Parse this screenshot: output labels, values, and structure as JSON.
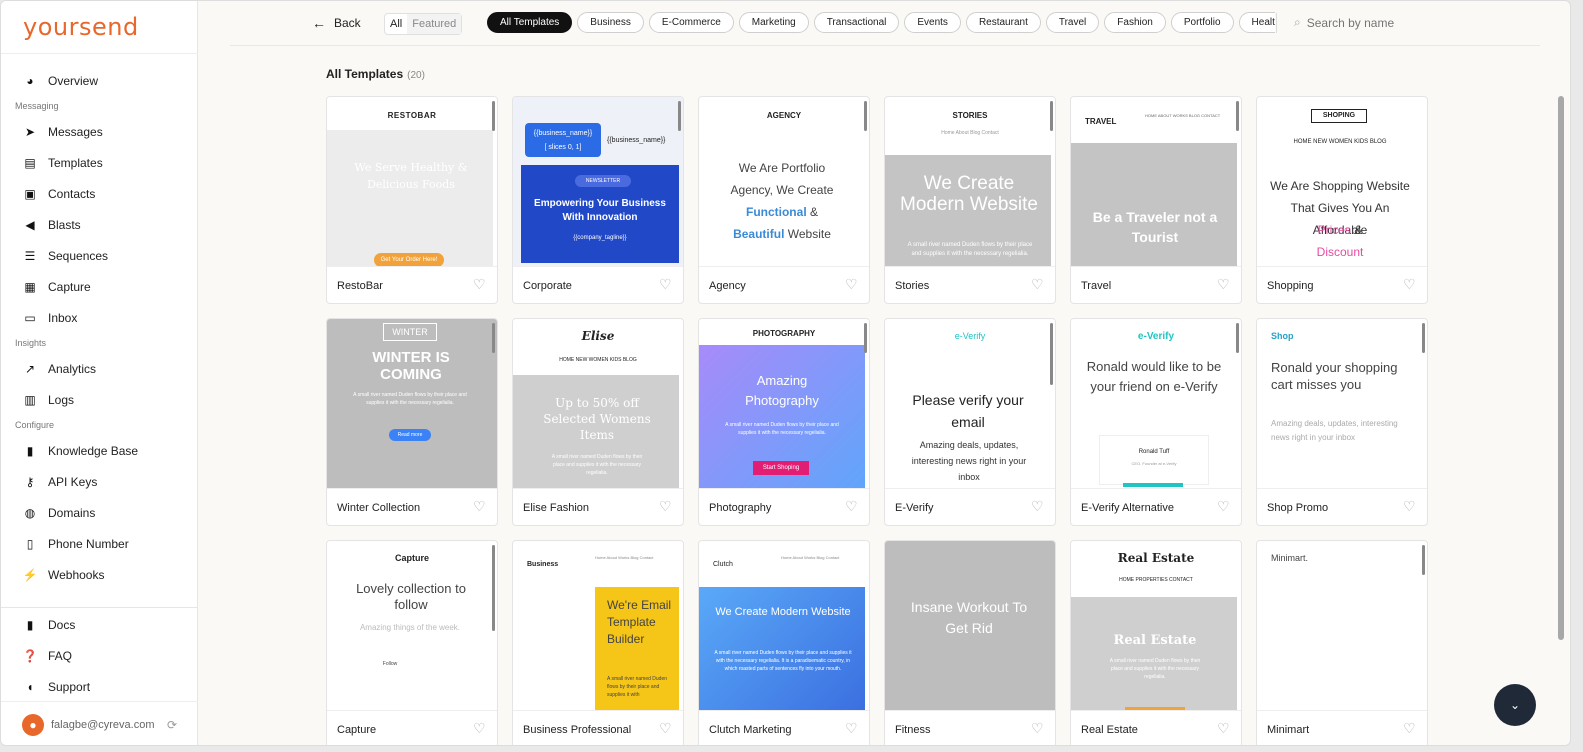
{
  "app": {
    "logo": "yoursend"
  },
  "sidebar": {
    "overview": "Overview",
    "sections": {
      "messaging": "Messaging",
      "insights": "Insights",
      "configure": "Configure"
    },
    "messaging": [
      "Messages",
      "Templates",
      "Contacts",
      "Blasts",
      "Sequences",
      "Capture",
      "Inbox"
    ],
    "insights": [
      "Analytics",
      "Logs"
    ],
    "configure": [
      "Knowledge Base",
      "API Keys",
      "Domains",
      "Phone Number",
      "Webhooks"
    ],
    "bottom": [
      "Docs",
      "FAQ",
      "Support"
    ],
    "user_email": "falagbe@cyreva.com"
  },
  "topbar": {
    "back_label": "Back",
    "toggle": [
      "All",
      "Featured"
    ],
    "chips": [
      "All Templates",
      "Business",
      "E-Commerce",
      "Marketing",
      "Transactional",
      "Events",
      "Restaurant",
      "Travel",
      "Fashion",
      "Portfolio",
      "Health &"
    ],
    "search_placeholder": "Search by name"
  },
  "main": {
    "title": "All Templates",
    "count": "(20)"
  },
  "cards": [
    {
      "name": "RestoBar",
      "t1": "RESTOBAR",
      "t2": "We Serve Healthy & Delicious Foods",
      "t3": "Get Your Order Here!"
    },
    {
      "name": "Corporate",
      "t1": "{{business_name}}",
      "t2": "[ slices 0, 1]",
      "t3": "{{business_name}}",
      "t4": "NEWSLETTER",
      "t5": "Empowering Your Business With Innovation",
      "t6": "{{company_tagline}}"
    },
    {
      "name": "Agency",
      "t1": "AGENCY",
      "t2": "We Are Portfolio Agency, We Create",
      "t3": "Functional",
      "t4": "&",
      "t5": "Beautiful",
      "t6": "Website"
    },
    {
      "name": "Stories",
      "t1": "STORIES",
      "t2": "Home  About  Blog  Contact",
      "t3": "We Create Modern Website",
      "t4": "A small river named Duden flows by their place and supplies it with the necessary regelialia."
    },
    {
      "name": "Travel",
      "t1": "TRAVEL",
      "t2": "HOME  ABOUT  WORKS  BLOG  CONTACT",
      "t3": "Be a Traveler not a Tourist"
    },
    {
      "name": "Shopping",
      "t1": "SHOPING",
      "t2": "HOME  NEW  WOMEN  KIDS  BLOG",
      "t3": "We Are Shopping Website That Gives You An Affordable",
      "t4": "Prices",
      "t5": "&",
      "t6": "Discount"
    },
    {
      "name": "Winter Collection",
      "t1": "WINTER",
      "t2": "WINTER IS COMING",
      "t3": "A small river named Duden flows by their place and supplies it with the necessary regelialia.",
      "t4": "Read more"
    },
    {
      "name": "Elise Fashion",
      "t1": "Elise",
      "t2": "HOME  NEW  WOMEN  KIDS  BLOG",
      "t3": "Up to 50% off Selected Womens Items",
      "t4": "A small river named Duden flows by their place and supplies it with the necessary regelialia."
    },
    {
      "name": "Photography",
      "t1": "PHOTOGRAPHY",
      "t2": "Amazing Photography",
      "t3": "A small river named Duden flows by their place and supplies it with the necessary regelialia.",
      "t4": "Start Shoping"
    },
    {
      "name": "E-Verify",
      "t1": "e-Verify",
      "t2": "Please verify your email",
      "t3": "Amazing deals, updates, interesting news right in your inbox"
    },
    {
      "name": "E-Verify Alternative",
      "t1": "e-Verify",
      "t2": "Ronald would like to be your friend on e-Verify",
      "t3": "Ronald Tuff",
      "t4": "CEO, Founder at e-Verify"
    },
    {
      "name": "Shop Promo",
      "t1": "Shop",
      "t2": "Ronald your shopping cart misses you",
      "t3": "Amazing deals, updates, interesting news right in your inbox"
    },
    {
      "name": "Capture",
      "t1": "Capture",
      "t2": "Lovely collection to follow",
      "t3": "Amazing things of the week.",
      "t4": "Follow"
    },
    {
      "name": "Business Professional",
      "t1": "Business",
      "t2": "Home  About  Works  Blog  Contact",
      "t3": "We're Email Template Builder",
      "t4": "A small river named Duden flows by their place and supplies it with"
    },
    {
      "name": "Clutch Marketing",
      "t1": "Clutch",
      "t2": "Home  About  Works  Blog  Contact",
      "t3": "We Create Modern Website",
      "t4": "A small river named Duden flows by their place and supplies it with the necessary regelialia. It is a paradisematic country, in which roasted parts of sentences fly into your mouth."
    },
    {
      "name": "Fitness",
      "t1": "Insane Workout To Get Rid"
    },
    {
      "name": "Real Estate",
      "t1": "Real Estate",
      "t2": "HOME  PROPERTIES  CONTACT",
      "t3": "Real Estate",
      "t4": "A small river named Duden flows by their place and supplies it with the necessary regelialia."
    },
    {
      "name": "Minimart",
      "t1": "Minimart."
    }
  ]
}
